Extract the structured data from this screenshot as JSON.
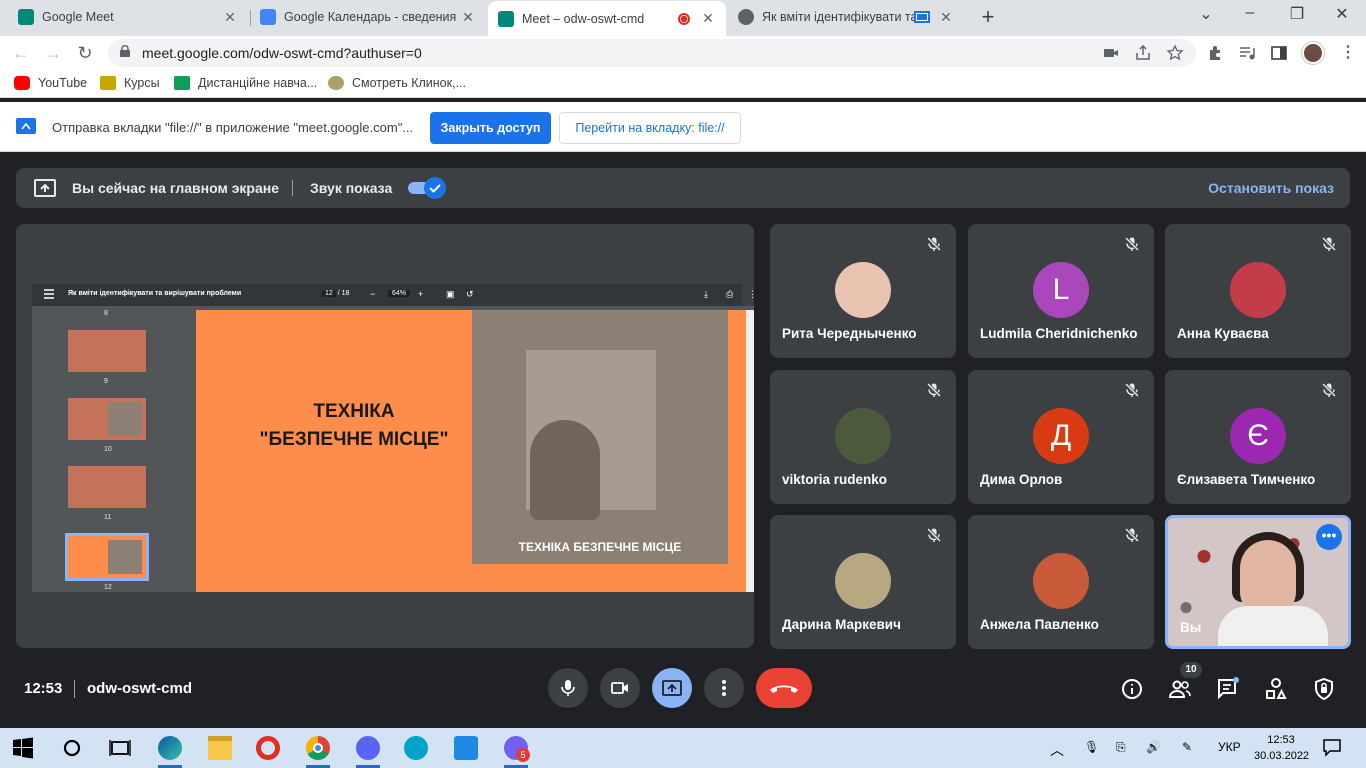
{
  "browser": {
    "tabs": [
      {
        "title": "Google Meet",
        "favicon_color": "#00897b",
        "active": false
      },
      {
        "title": "Google Календарь - сведения о",
        "favicon_color": "#4285f4",
        "active": false
      },
      {
        "title": "Meet – odw-oswt-cmd",
        "favicon_color": "#00897b",
        "active": true
      },
      {
        "title": "Як вміти ідентифікувати та",
        "favicon_color": "#5f6368",
        "active": false
      }
    ],
    "url": "meet.google.com/odw-oswt-cmd?authuser=0",
    "bookmarks": [
      {
        "label": "YouTube",
        "icon_color": "#ff0000"
      },
      {
        "label": "Курсы",
        "icon_color": "#c6a700"
      },
      {
        "label": "Дистанційне навча...",
        "icon_color": "#0f9d58"
      },
      {
        "label": "Смотреть Клинок,...",
        "icon_color": "#a8a26a"
      }
    ],
    "infobar": {
      "text": "Отправка вкладки \"file://\" в приложение \"meet.google.com\"...",
      "close_access": "Закрыть доступ",
      "go_to_tab": "Перейти на вкладку: file://"
    }
  },
  "meet": {
    "present_bar": {
      "main_screen": "Вы сейчас на главном экране",
      "audio": "Звук показа",
      "audio_on": true,
      "stop": "Остановить показ"
    },
    "pdf": {
      "title": "Як вміти ідентифікувати та вирішувати проблеми",
      "page": "12",
      "page_total": "/ 18",
      "zoom": "64%",
      "thumbs": [
        {
          "num": "8"
        },
        {
          "num": "9"
        },
        {
          "num": "10"
        },
        {
          "num": "11"
        },
        {
          "num": "12",
          "selected": true
        }
      ],
      "slide": {
        "title_line1": "ТЕХНІКА",
        "title_line2": "\"БЕЗПЕЧНЕ МІСЦЕ\"",
        "caption": "ТЕХНІКА БЕЗПЕЧНЕ МІСЦЕ"
      }
    },
    "participants": [
      {
        "name": "Рита Чередныченко",
        "initial": "",
        "avatar_color": "#e8c4b0",
        "muted": true
      },
      {
        "name": "Ludmila Cheridnichenko",
        "initial": "L",
        "avatar_color": "#ab47bc",
        "muted": true
      },
      {
        "name": "Анна Куваєва",
        "initial": "",
        "avatar_color": "#c43c4a",
        "muted": true
      },
      {
        "name": "viktoria rudenko",
        "initial": "",
        "avatar_color": "#4a5a3a",
        "muted": true
      },
      {
        "name": "Дима Орлов",
        "initial": "Д",
        "avatar_color": "#d93a12",
        "muted": true
      },
      {
        "name": "Єлизавета Тимченко",
        "initial": "Є",
        "avatar_color": "#9c27b0",
        "muted": true
      },
      {
        "name": "Дарина Маркевич",
        "initial": "",
        "avatar_color": "#b7a882",
        "muted": true
      },
      {
        "name": "Анжела Павленко",
        "initial": "",
        "avatar_color": "#c85a3a",
        "muted": true
      },
      {
        "name": "Вы",
        "initial": "",
        "avatar_color": "",
        "muted": false
      }
    ],
    "bottom": {
      "time": "12:53",
      "code": "odw-oswt-cmd",
      "people_count": "10"
    }
  },
  "taskbar": {
    "lang": "УКР",
    "time": "12:53",
    "date": "30.03.2022",
    "viber_badge": "5"
  }
}
